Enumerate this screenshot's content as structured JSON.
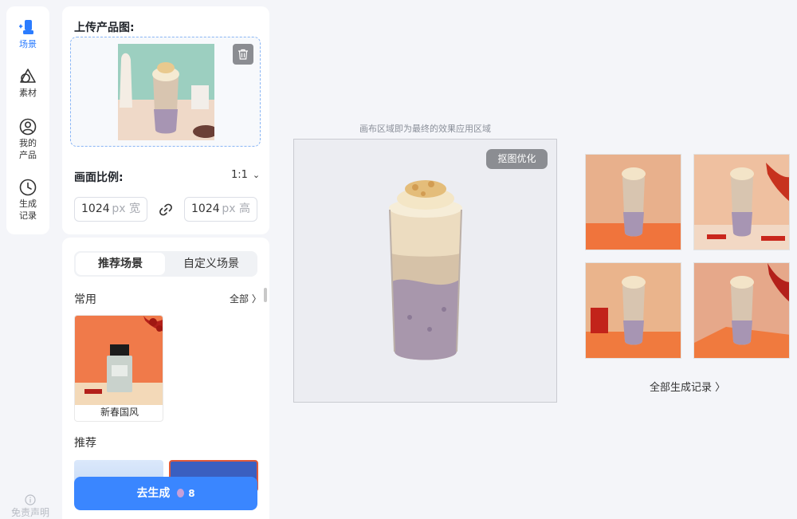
{
  "nav": {
    "items": [
      {
        "label": "场景",
        "icon": "scene-icon",
        "active": true
      },
      {
        "label": "素材",
        "icon": "material-icon",
        "active": false
      },
      {
        "label_line1": "我的",
        "label_line2": "产品",
        "icon": "user-icon",
        "active": false
      },
      {
        "label_line1": "生成",
        "label_line2": "记录",
        "icon": "clock-icon",
        "active": false
      }
    ],
    "disclaimer": "免责声明"
  },
  "upload": {
    "title": "上传产品图:",
    "delete_icon": "trash-icon"
  },
  "ratio": {
    "label": "画面比例:",
    "value": "1:1",
    "width": "1024",
    "height": "1024",
    "width_unit": "px 宽",
    "height_unit": "px 高",
    "link_icon": "link-icon"
  },
  "scenes": {
    "tabs": [
      "推荐场景",
      "自定义场景"
    ],
    "active_tab": 0,
    "common_title": "常用",
    "all_label": "全部 〉",
    "common_items": [
      {
        "label": "新春国风"
      }
    ],
    "recommend_title": "推荐"
  },
  "generate": {
    "label": "去生成",
    "cost": "8"
  },
  "canvas": {
    "hint": "画布区域即为最终的效果应用区域",
    "cutout_button": "抠图优化"
  },
  "results": {
    "all_records": "全部生成记录 〉"
  },
  "colors": {
    "accent": "#2b7cff",
    "button": "#3a86ff",
    "background": "#f4f5f9"
  }
}
